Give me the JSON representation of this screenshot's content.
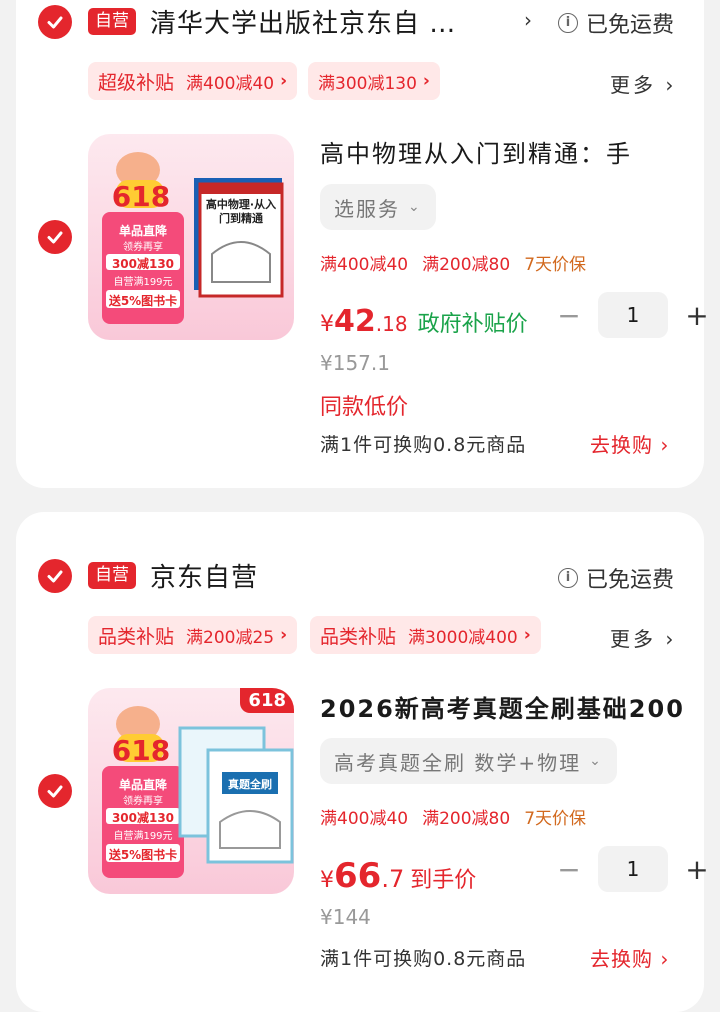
{
  "stores": [
    {
      "badge": "自营",
      "name": "清华大学出版社京东自 …",
      "shipping": "已免运费",
      "promos": [
        {
          "name": "超级补贴",
          "value": "满400减40"
        },
        {
          "name": "",
          "value": "满300减130"
        }
      ],
      "more": "更多",
      "product": {
        "title": "高中物理从入门到精通：手",
        "service": "选服务",
        "tags": [
          "满400减40",
          "满200减80",
          "7天价保"
        ],
        "price_currency": "¥",
        "price_int": "42",
        "price_dec": ".18",
        "price_tag": "政府补贴价",
        "original_price": "¥157.1",
        "same_low": "同款低价",
        "swap_text": "满1件可换购0.8元商品",
        "swap_link": "去换购",
        "quantity": "1",
        "book_title": "高中物理·从入门到精通",
        "promo_lines": [
          "618",
          "单品直降",
          "领券再享",
          "300减130",
          "自营满199元",
          "送5%图书卡"
        ]
      }
    },
    {
      "badge": "自营",
      "name": "京东自营",
      "shipping": "已免运费",
      "promos": [
        {
          "name": "品类补贴",
          "value": "满200减25"
        },
        {
          "name": "品类补贴",
          "value": "满3000减400"
        }
      ],
      "more": "更多",
      "product": {
        "title": "2026新高考真题全刷基础200",
        "service": "高考真题全刷 数学+物理",
        "tags": [
          "满400减40",
          "满200减80",
          "7天价保"
        ],
        "price_currency": "¥",
        "price_int": "66",
        "price_dec": ".7",
        "price_tag": "到手价",
        "original_price": "¥144",
        "swap_text": "满1件可换购0.8元商品",
        "swap_link": "去换购",
        "quantity": "1",
        "corner_badge": "618",
        "book_title": "真题全刷",
        "promo_lines": [
          "618",
          "单品直降",
          "领券再享",
          "300减130",
          "自营满199元",
          "送5%图书卡"
        ]
      }
    }
  ],
  "colors": {
    "accent": "#e4262d",
    "orange": "#d2691e",
    "pill_bg": "#ffe8e8"
  }
}
